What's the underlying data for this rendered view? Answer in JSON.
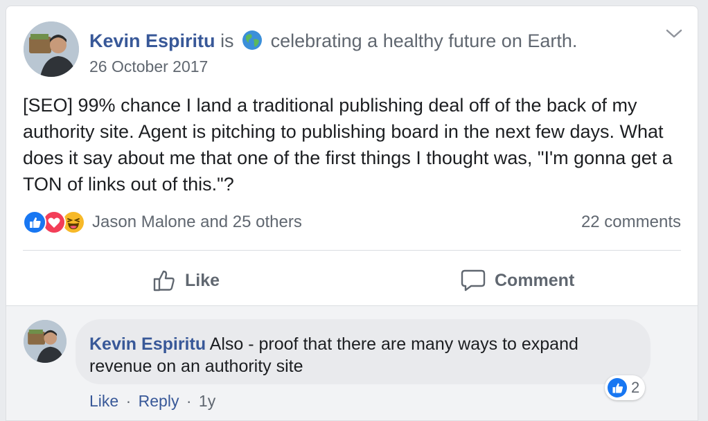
{
  "post": {
    "author": "Kevin Espiritu",
    "is_word": "is",
    "activity": "celebrating a healthy future on Earth.",
    "date": "26 October 2017",
    "text": "[SEO] 99% chance I land a traditional publishing deal off of the back of my authority site. Agent is pitching to publishing board in the next few days. What does it say about me that one of the first things I thought was, \"I'm gonna get a TON of links out of this.\"?",
    "reactions": {
      "icons": [
        "like-reaction-icon",
        "love-reaction-icon",
        "haha-reaction-icon"
      ],
      "text": "Jason Malone and 25 others"
    },
    "comments_count": "22 comments",
    "actions": {
      "like_label": "Like",
      "comment_label": "Comment"
    }
  },
  "comment": {
    "author": "Kevin Espiritu",
    "text": "Also - proof that there are many ways to expand revenue on an authority site",
    "likes": "2",
    "like_link": "Like",
    "separator": "·",
    "reply_link": "Reply",
    "age": "1y"
  },
  "colors": {
    "link_blue": "#385898",
    "reaction_like": "#1877f2",
    "reaction_love": "#f33e58",
    "reaction_haha": "#f7b928"
  }
}
